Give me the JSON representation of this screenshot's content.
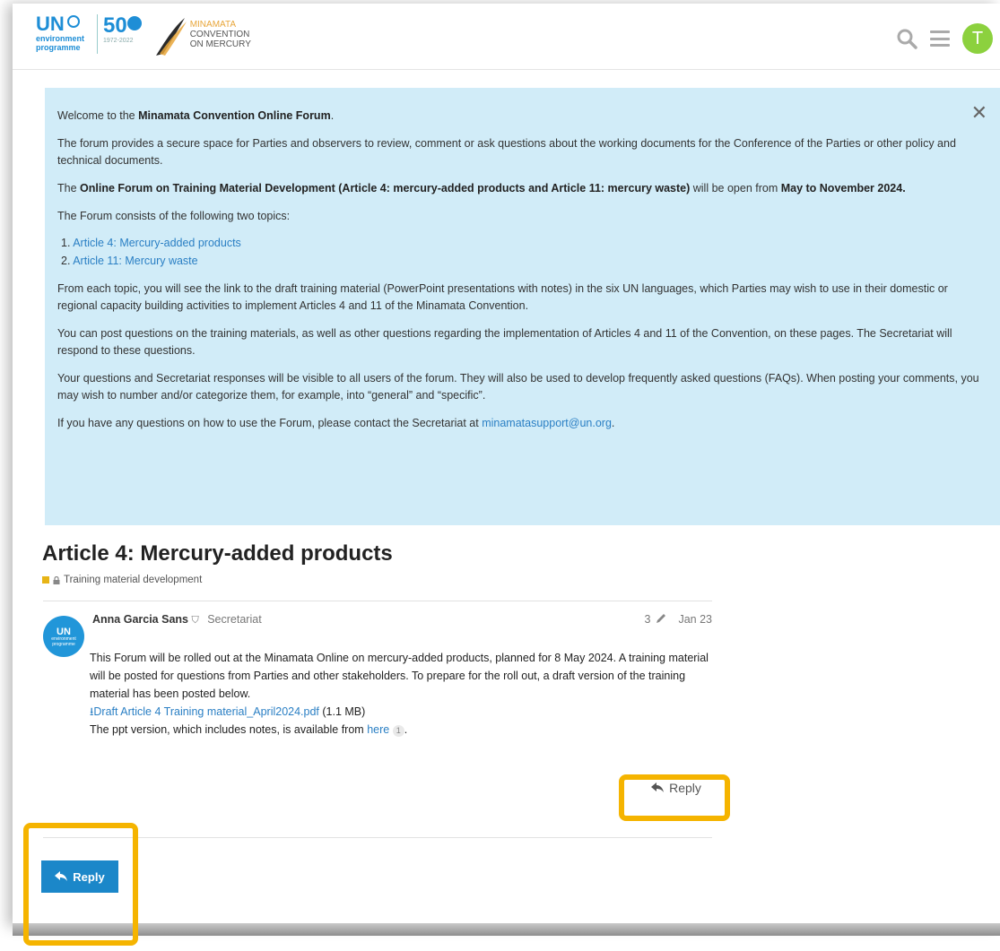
{
  "header": {
    "un_text": "UN",
    "un_sub1": "environment",
    "un_sub2": "programme",
    "fifty": "50",
    "fifty_years": "1972-2022",
    "minamata1": "MINAMATA",
    "minamata2": "CONVENTION",
    "minamata3": "ON MERCURY",
    "avatar_letter": "T",
    "icons": [
      "search-icon",
      "hamburger-menu-icon"
    ],
    "avatar_color": "#8cd13e"
  },
  "banner": {
    "p1_pre": "Welcome to the ",
    "p1_bold": "Minamata Convention Online Forum",
    "p1_post": ".",
    "p2": "The forum provides a secure space for Parties and observers to review, comment or ask questions about the working documents for the Conference of the Parties or other policy and technical documents.",
    "p3_pre": "The ",
    "p3_bold": "Online Forum on Training Material Development (Article 4: mercury-added products and Article 11: mercury waste)",
    "p3_mid": " will be open from ",
    "p3_bold2": "May to November 2024.",
    "p4": "The Forum consists of the following two topics:",
    "list": [
      {
        "num": "1. ",
        "label": "Article 4: Mercury-added products"
      },
      {
        "num": "2. ",
        "label": "Article 11: Mercury waste"
      }
    ],
    "p5": "From each topic, you will see the link to the draft training material (PowerPoint presentations with notes) in the six UN languages, which Parties may wish to use in their domestic or regional capacity building activities to implement Articles 4 and 11 of the Minamata Convention.",
    "p6": "You can post questions on the training materials, as well as other questions regarding the implementation of Articles 4 and 11 of the Convention, on these pages. The Secretariat will respond to these questions.",
    "p7": "Your questions and Secretariat responses will be visible to all users of the forum. They will also be used to develop frequently asked questions (FAQs). When posting your comments, you may wish to number and/or categorize them, for example, into “general” and “specific”.",
    "p8_pre": "If you have any questions on how to use the Forum, please contact the Secretariat at ",
    "p8_link": "minamatasupport@un.org",
    "p8_post": ".",
    "close": "✕",
    "background": "#d1ecf8"
  },
  "topic": {
    "title": "Article 4: Mercury-added products",
    "category": "Training material development",
    "category_color": "#e7b416"
  },
  "post": {
    "avatar_text": "UN",
    "avatar_sub": "environment programme",
    "author": "Anna Garcia Sans",
    "role": "Secretariat",
    "edits": "3",
    "date": "Jan 23",
    "line1": "This Forum will be rolled out at the Minamata Online on mercury-added products, planned for 8 May 2024. A training material will be posted for questions from Parties and other stakeholders. To prepare for the roll out, a draft version of the training material has been posted below.",
    "attachment": "Draft Article 4 Training material_April2024.pdf",
    "attachment_size": " (1.1 MB)",
    "line3_pre": "The ppt version, which includes notes, is available from ",
    "line3_link": "here",
    "line3_badge": "1",
    "line3_post": ".",
    "reply_label": "Reply"
  },
  "footer": {
    "reply_label": "Reply",
    "reply_color": "#1b87c9",
    "highlight_color": "#f5b400"
  }
}
